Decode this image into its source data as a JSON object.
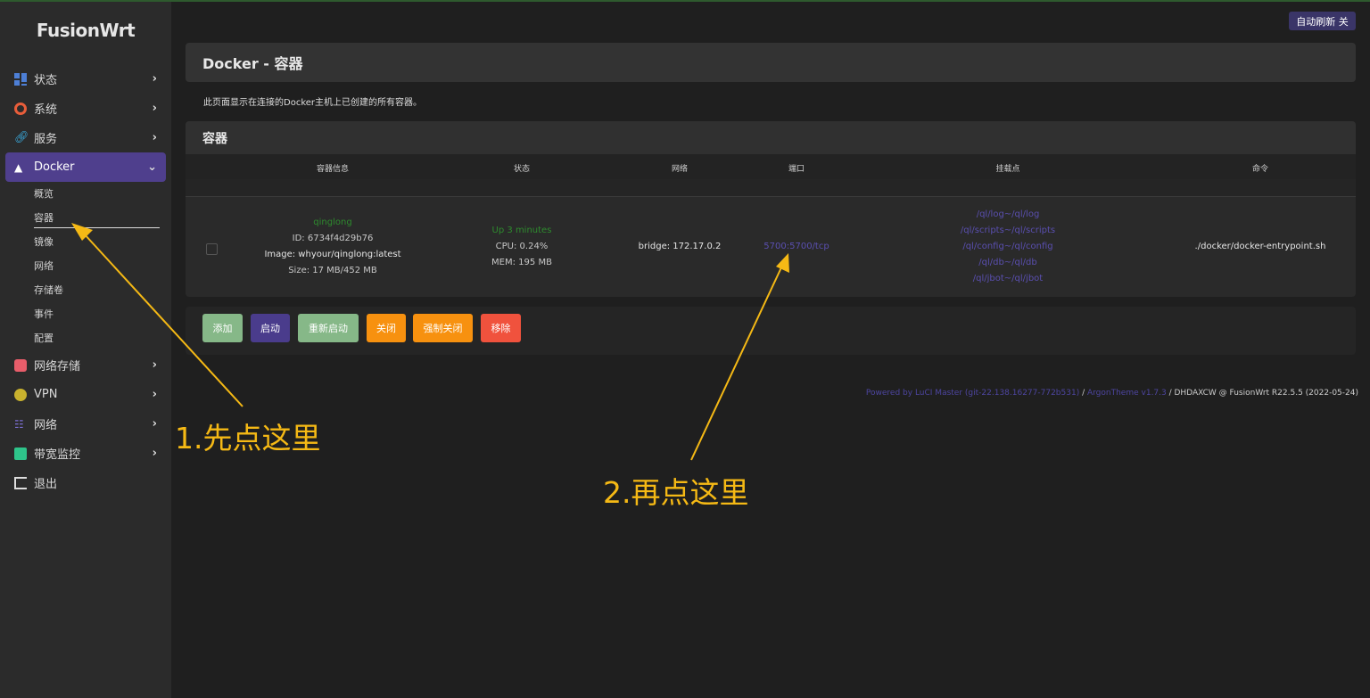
{
  "sidebar": {
    "brand": "FusionWrt",
    "items": [
      {
        "label": "状态",
        "icon": "dashboard-icon"
      },
      {
        "label": "系统",
        "icon": "gear-icon"
      },
      {
        "label": "服务",
        "icon": "link-icon"
      },
      {
        "label": "Docker",
        "icon": "docker-icon",
        "active": true
      },
      {
        "label": "网络存储",
        "icon": "database-icon"
      },
      {
        "label": "VPN",
        "icon": "globe-icon"
      },
      {
        "label": "网络",
        "icon": "network-icon"
      },
      {
        "label": "带宽监控",
        "icon": "monitor-icon"
      },
      {
        "label": "退出",
        "icon": "logout-icon"
      }
    ],
    "docker_sub": [
      "概览",
      "容器",
      "镜像",
      "网络",
      "存储卷",
      "事件",
      "配置"
    ]
  },
  "header": {
    "refresh": "自动刷新 关",
    "title": "Docker - 容器",
    "desc": "此页面显示在连接的Docker主机上已创建的所有容器。"
  },
  "containers": {
    "title": "容器",
    "columns": [
      "容器信息",
      "状态",
      "网络",
      "端口",
      "挂载点",
      "命令"
    ],
    "row": {
      "name": "qinglong",
      "id": "ID: 6734f4d29b76",
      "image": "Image: whyour/qinglong:latest",
      "size": "Size: 17 MB/452 MB",
      "status": "Up 3 minutes",
      "cpu": "CPU: 0.24%",
      "mem": "MEM: 195 MB",
      "network": "bridge: 172.17.0.2",
      "port": "5700:5700/tcp",
      "mounts": [
        "/ql/log~/ql/log",
        "/ql/scripts~/ql/scripts",
        "/ql/config~/ql/config",
        "/ql/db~/ql/db",
        "/ql/jbot~/ql/jbot"
      ],
      "command": "./docker/docker-entrypoint.sh"
    }
  },
  "actions": {
    "add": "添加",
    "start": "启动",
    "restart": "重新启动",
    "stop": "关闭",
    "kill": "强制关闭",
    "remove": "移除"
  },
  "footer": {
    "powered": "Powered by LuCI Master (git-22.138.16277-772b531)",
    "sep1": " / ",
    "theme": "ArgonTheme v1.7.3",
    "rest": " / DHDAXCW @ FusionWrt R22.5.5 (2022-05-24)"
  },
  "annotations": {
    "first": "1.先点这里",
    "second": "2.再点这里"
  },
  "colors": {
    "accent": "#4f3f8d",
    "annotation": "#f5b915",
    "add": "#86b888",
    "start": "#4a3c8c",
    "restart": "#86b888",
    "stop": "#f7910f",
    "kill": "#f7910f",
    "remove": "#f0523d"
  }
}
